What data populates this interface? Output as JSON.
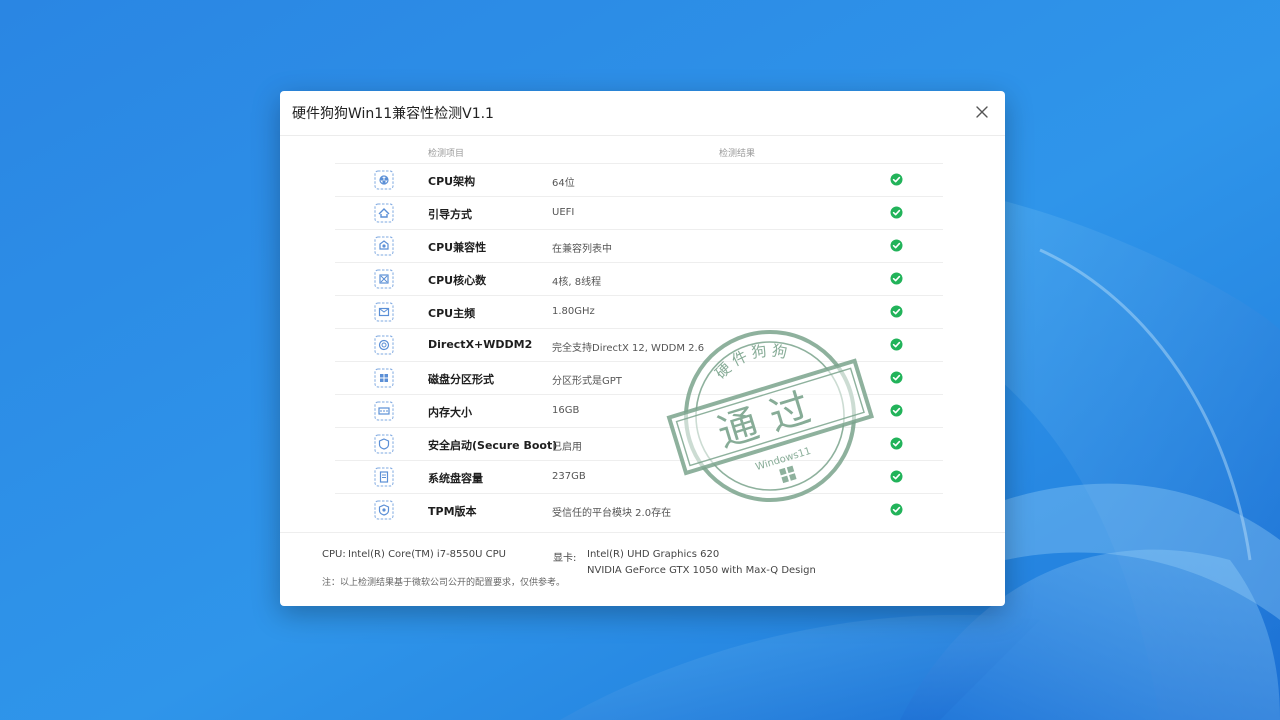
{
  "dialog": {
    "title": "硬件狗狗Win11兼容性检测V1.1"
  },
  "table": {
    "header_item": "检测项目",
    "header_result": "检测结果",
    "rows": [
      {
        "item": "CPU架构",
        "result": "64位",
        "icon": "cpu-chip-icon",
        "status": "pass"
      },
      {
        "item": "引导方式",
        "result": "UEFI",
        "icon": "boot-icon",
        "status": "pass"
      },
      {
        "item": "CPU兼容性",
        "result": "在兼容列表中",
        "icon": "compat-icon",
        "status": "pass"
      },
      {
        "item": "CPU核心数",
        "result": "4核, 8线程",
        "icon": "cores-icon",
        "status": "pass"
      },
      {
        "item": "CPU主频",
        "result": "1.80GHz",
        "icon": "frequency-icon",
        "status": "pass"
      },
      {
        "item": "DirectX+WDDM2",
        "result": "完全支持DirectX 12, WDDM 2.6",
        "icon": "directx-icon",
        "status": "pass"
      },
      {
        "item": "磁盘分区形式",
        "result": "分区形式是GPT",
        "icon": "partition-icon",
        "status": "pass"
      },
      {
        "item": "内存大小",
        "result": "16GB",
        "icon": "memory-icon",
        "status": "pass"
      },
      {
        "item": "安全启动(Secure Boot)",
        "result": "已启用",
        "icon": "secure-boot-icon",
        "status": "pass"
      },
      {
        "item": "系统盘容量",
        "result": "237GB",
        "icon": "disk-icon",
        "status": "pass"
      },
      {
        "item": "TPM版本",
        "result": "受信任的平台模块 2.0存在",
        "icon": "tpm-icon",
        "status": "pass"
      }
    ]
  },
  "footer": {
    "cpu_label": "CPU:",
    "cpu_value": "Intel(R) Core(TM) i7-8550U CPU",
    "gpu_label": "显卡:",
    "gpu_value_1": "Intel(R) UHD Graphics 620",
    "gpu_value_2": "NVIDIA GeForce GTX 1050 with Max-Q Design",
    "note": "注：以上检测结果基于微软公司公开的配置要求，仅供参考。"
  },
  "stamp": {
    "top_text": "硬件狗狗",
    "main_text": "通过",
    "bottom_text": "Windows11"
  },
  "colors": {
    "check_green": "#22b35a",
    "icon_blue": "#5b8fd6",
    "stamp_green": "#7aa38c"
  }
}
